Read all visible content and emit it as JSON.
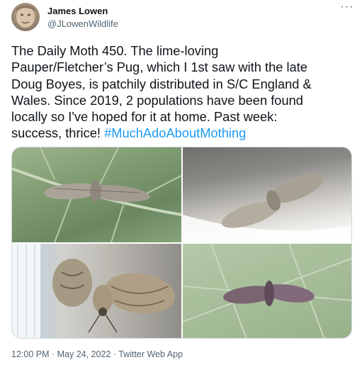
{
  "user": {
    "name": "James Lowen",
    "handle": "@JLowenWildlife"
  },
  "tweet": {
    "lines": [
      "The Daily Moth 450. The lime-loving",
      "Pauper/Fletcher’s Pug, which I 1st saw with the late",
      "Doug Boyes, is patchily distributed in S/C England &",
      "Wales. Since 2019, 2 populations have been found",
      "locally so I've hoped for it at home. Past week:",
      "success, thrice! "
    ],
    "hashtag": "#MuchAdoAboutMothing",
    "more_glyph": "···"
  },
  "footer": {
    "meta": "12:00 PM · May 24, 2022 · Twitter Web App"
  },
  "colors": {
    "text": "#0f1419",
    "secondary": "#536471",
    "link": "#1d9bf0"
  },
  "icons": [
    "more-icon"
  ]
}
